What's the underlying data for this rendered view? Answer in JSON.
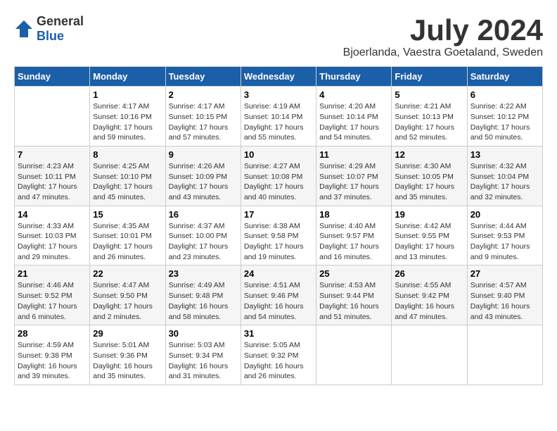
{
  "logo": {
    "general": "General",
    "blue": "Blue"
  },
  "title": "July 2024",
  "location": "Bjoerlanda, Vaestra Goetaland, Sweden",
  "days_header": [
    "Sunday",
    "Monday",
    "Tuesday",
    "Wednesday",
    "Thursday",
    "Friday",
    "Saturday"
  ],
  "weeks": [
    [
      {
        "num": "",
        "sunrise": "",
        "sunset": "",
        "daylight": ""
      },
      {
        "num": "1",
        "sunrise": "Sunrise: 4:17 AM",
        "sunset": "Sunset: 10:16 PM",
        "daylight": "Daylight: 17 hours and 59 minutes."
      },
      {
        "num": "2",
        "sunrise": "Sunrise: 4:17 AM",
        "sunset": "Sunset: 10:15 PM",
        "daylight": "Daylight: 17 hours and 57 minutes."
      },
      {
        "num": "3",
        "sunrise": "Sunrise: 4:19 AM",
        "sunset": "Sunset: 10:14 PM",
        "daylight": "Daylight: 17 hours and 55 minutes."
      },
      {
        "num": "4",
        "sunrise": "Sunrise: 4:20 AM",
        "sunset": "Sunset: 10:14 PM",
        "daylight": "Daylight: 17 hours and 54 minutes."
      },
      {
        "num": "5",
        "sunrise": "Sunrise: 4:21 AM",
        "sunset": "Sunset: 10:13 PM",
        "daylight": "Daylight: 17 hours and 52 minutes."
      },
      {
        "num": "6",
        "sunrise": "Sunrise: 4:22 AM",
        "sunset": "Sunset: 10:12 PM",
        "daylight": "Daylight: 17 hours and 50 minutes."
      }
    ],
    [
      {
        "num": "7",
        "sunrise": "Sunrise: 4:23 AM",
        "sunset": "Sunset: 10:11 PM",
        "daylight": "Daylight: 17 hours and 47 minutes."
      },
      {
        "num": "8",
        "sunrise": "Sunrise: 4:25 AM",
        "sunset": "Sunset: 10:10 PM",
        "daylight": "Daylight: 17 hours and 45 minutes."
      },
      {
        "num": "9",
        "sunrise": "Sunrise: 4:26 AM",
        "sunset": "Sunset: 10:09 PM",
        "daylight": "Daylight: 17 hours and 43 minutes."
      },
      {
        "num": "10",
        "sunrise": "Sunrise: 4:27 AM",
        "sunset": "Sunset: 10:08 PM",
        "daylight": "Daylight: 17 hours and 40 minutes."
      },
      {
        "num": "11",
        "sunrise": "Sunrise: 4:29 AM",
        "sunset": "Sunset: 10:07 PM",
        "daylight": "Daylight: 17 hours and 37 minutes."
      },
      {
        "num": "12",
        "sunrise": "Sunrise: 4:30 AM",
        "sunset": "Sunset: 10:05 PM",
        "daylight": "Daylight: 17 hours and 35 minutes."
      },
      {
        "num": "13",
        "sunrise": "Sunrise: 4:32 AM",
        "sunset": "Sunset: 10:04 PM",
        "daylight": "Daylight: 17 hours and 32 minutes."
      }
    ],
    [
      {
        "num": "14",
        "sunrise": "Sunrise: 4:33 AM",
        "sunset": "Sunset: 10:03 PM",
        "daylight": "Daylight: 17 hours and 29 minutes."
      },
      {
        "num": "15",
        "sunrise": "Sunrise: 4:35 AM",
        "sunset": "Sunset: 10:01 PM",
        "daylight": "Daylight: 17 hours and 26 minutes."
      },
      {
        "num": "16",
        "sunrise": "Sunrise: 4:37 AM",
        "sunset": "Sunset: 10:00 PM",
        "daylight": "Daylight: 17 hours and 23 minutes."
      },
      {
        "num": "17",
        "sunrise": "Sunrise: 4:38 AM",
        "sunset": "Sunset: 9:58 PM",
        "daylight": "Daylight: 17 hours and 19 minutes."
      },
      {
        "num": "18",
        "sunrise": "Sunrise: 4:40 AM",
        "sunset": "Sunset: 9:57 PM",
        "daylight": "Daylight: 17 hours and 16 minutes."
      },
      {
        "num": "19",
        "sunrise": "Sunrise: 4:42 AM",
        "sunset": "Sunset: 9:55 PM",
        "daylight": "Daylight: 17 hours and 13 minutes."
      },
      {
        "num": "20",
        "sunrise": "Sunrise: 4:44 AM",
        "sunset": "Sunset: 9:53 PM",
        "daylight": "Daylight: 17 hours and 9 minutes."
      }
    ],
    [
      {
        "num": "21",
        "sunrise": "Sunrise: 4:46 AM",
        "sunset": "Sunset: 9:52 PM",
        "daylight": "Daylight: 17 hours and 6 minutes."
      },
      {
        "num": "22",
        "sunrise": "Sunrise: 4:47 AM",
        "sunset": "Sunset: 9:50 PM",
        "daylight": "Daylight: 17 hours and 2 minutes."
      },
      {
        "num": "23",
        "sunrise": "Sunrise: 4:49 AM",
        "sunset": "Sunset: 9:48 PM",
        "daylight": "Daylight: 16 hours and 58 minutes."
      },
      {
        "num": "24",
        "sunrise": "Sunrise: 4:51 AM",
        "sunset": "Sunset: 9:46 PM",
        "daylight": "Daylight: 16 hours and 54 minutes."
      },
      {
        "num": "25",
        "sunrise": "Sunrise: 4:53 AM",
        "sunset": "Sunset: 9:44 PM",
        "daylight": "Daylight: 16 hours and 51 minutes."
      },
      {
        "num": "26",
        "sunrise": "Sunrise: 4:55 AM",
        "sunset": "Sunset: 9:42 PM",
        "daylight": "Daylight: 16 hours and 47 minutes."
      },
      {
        "num": "27",
        "sunrise": "Sunrise: 4:57 AM",
        "sunset": "Sunset: 9:40 PM",
        "daylight": "Daylight: 16 hours and 43 minutes."
      }
    ],
    [
      {
        "num": "28",
        "sunrise": "Sunrise: 4:59 AM",
        "sunset": "Sunset: 9:38 PM",
        "daylight": "Daylight: 16 hours and 39 minutes."
      },
      {
        "num": "29",
        "sunrise": "Sunrise: 5:01 AM",
        "sunset": "Sunset: 9:36 PM",
        "daylight": "Daylight: 16 hours and 35 minutes."
      },
      {
        "num": "30",
        "sunrise": "Sunrise: 5:03 AM",
        "sunset": "Sunset: 9:34 PM",
        "daylight": "Daylight: 16 hours and 31 minutes."
      },
      {
        "num": "31",
        "sunrise": "Sunrise: 5:05 AM",
        "sunset": "Sunset: 9:32 PM",
        "daylight": "Daylight: 16 hours and 26 minutes."
      },
      {
        "num": "",
        "sunrise": "",
        "sunset": "",
        "daylight": ""
      },
      {
        "num": "",
        "sunrise": "",
        "sunset": "",
        "daylight": ""
      },
      {
        "num": "",
        "sunrise": "",
        "sunset": "",
        "daylight": ""
      }
    ]
  ]
}
